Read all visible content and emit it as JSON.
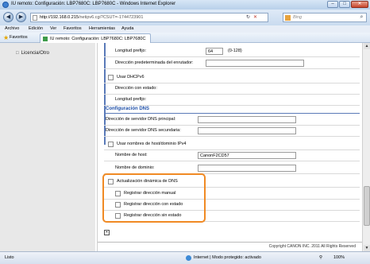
{
  "window": {
    "title": "IU remoto: Configuración: LBP7680C: LBP7680C - Windows Internet Explorer",
    "minimize": "–",
    "maximize": "□",
    "close": "✕"
  },
  "navbar": {
    "back": "◀",
    "forward": "▶",
    "address_host": "http://192.168.0.215",
    "address_path": "/netipv6.cgi?CSUT=-1744723901",
    "refresh": "↻",
    "stop": "✕",
    "search_placeholder": "Bing",
    "search_go": "⌕"
  },
  "menubar": [
    "Archivo",
    "Edición",
    "Ver",
    "Favoritos",
    "Herramientas",
    "Ayuda"
  ],
  "favorites": {
    "button": "Favoritos",
    "tab_title": "IU remoto: Configuración: LBP7680C: LBP7680C"
  },
  "sidebar": {
    "items": [
      {
        "label": "Licencia/Otro"
      }
    ]
  },
  "form": {
    "prefix_label": "Longitud prefijo:",
    "prefix_value": "64",
    "prefix_hint": "(0-128)",
    "router_label": "Dirección predeterminada del enrutador:",
    "router_value": "",
    "dhcpv6_label": "Usar DHCPv6",
    "stateful_label": "Dirección con estado:",
    "prefix2_label": "Longitud prefijo:",
    "dns_section": "Configuración DNS",
    "dns_primary_label": "Dirección de servidor DNS principal:",
    "dns_primary_value": "",
    "dns_secondary_label": "Dirección de servidor DNS secundaria:",
    "dns_secondary_value": "",
    "use_host_label": "Usar nombres de host/dominio IPv4",
    "host_label": "Nombre de host:",
    "host_value": "CanonF2CD57",
    "domain_label": "Nombre de dominio:",
    "domain_value": "",
    "dyn_dns_label": "Actualización dinámica de DNS",
    "manual_label": "Registrar dirección manual",
    "stateful_reg_label": "Registrar dirección con estado",
    "stateless_reg_label": "Registrar dirección sin estado"
  },
  "footer": {
    "copyright": "Copyright CANON INC. 2011 All Rights Reserved"
  },
  "status": {
    "left": "Listo",
    "zone": "Internet | Modo protegido: activado",
    "zoom": "100%"
  }
}
